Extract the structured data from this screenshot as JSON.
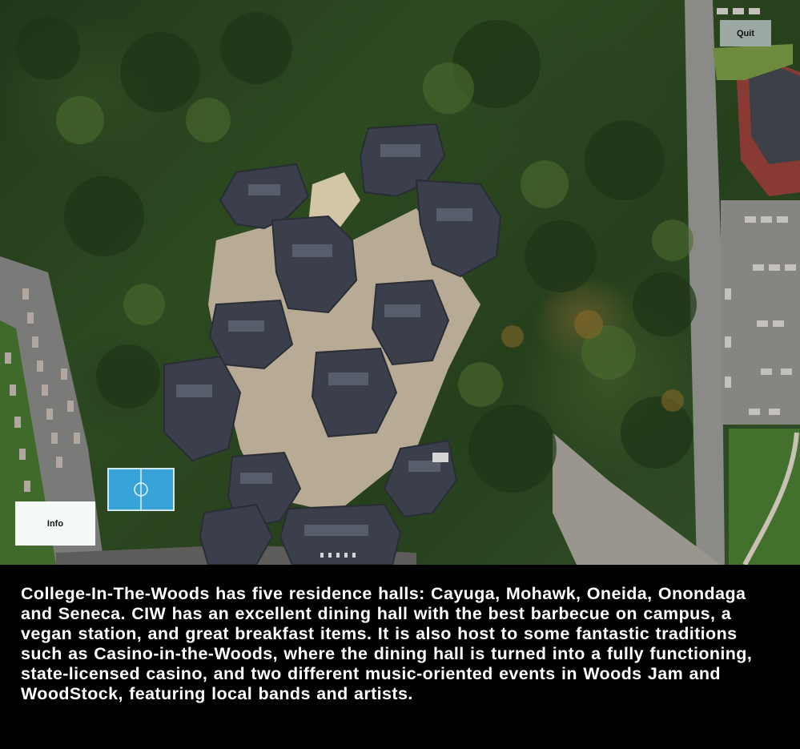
{
  "controls": {
    "quit_label": "Quit",
    "info_label": "Info"
  },
  "description": {
    "text": "College-In-The-Woods has five residence halls: Cayuga, Mohawk, Oneida, Onondaga and Seneca. CIW has an excellent dining hall with the best barbecue on campus, a vegan station, and great breakfast items. It is also host to some fantastic traditions such as Casino-in-the-Woods, where the dining hall is turned into a fully functioning, state-licensed casino, and two different music-oriented events in Woods Jam and WoodStock, featuring local bands and artists."
  },
  "colors": {
    "panel_background": "#000000",
    "text": "#ffffff",
    "quit_button": "#9ca8a2",
    "info_button": "#f5f9f7",
    "roof": "#3b3f4c",
    "tree_canopy": "#2d4a21",
    "court": "#3aa0d8"
  }
}
